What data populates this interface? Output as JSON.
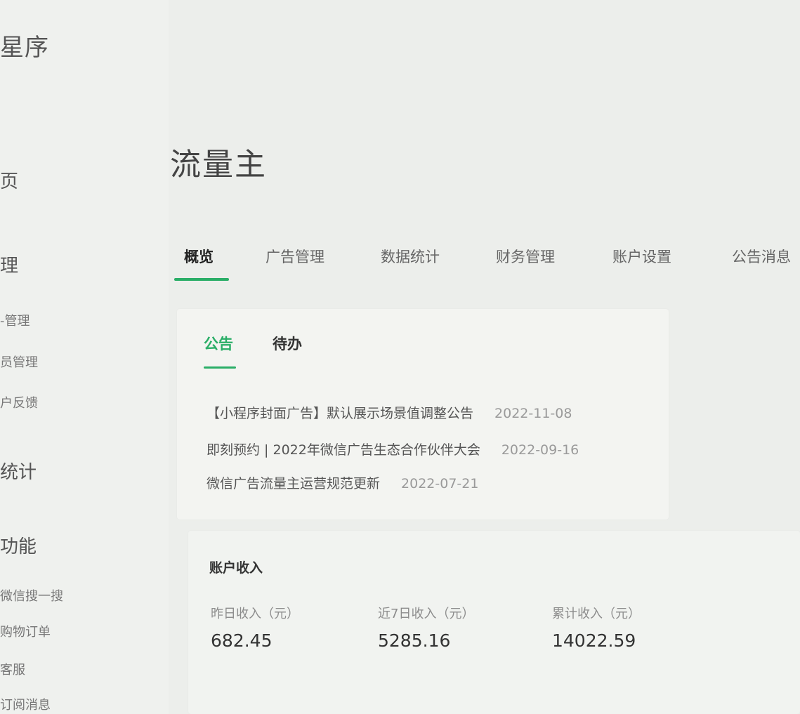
{
  "sidebar": {
    "brand": "星序",
    "items": [
      {
        "label": "页",
        "size": "big"
      },
      {
        "label": "理",
        "size": "big"
      },
      {
        "label": "-管理",
        "size": "small"
      },
      {
        "label": "员管理",
        "size": "small"
      },
      {
        "label": "户反馈",
        "size": "small"
      },
      {
        "label": "统计",
        "size": "big"
      },
      {
        "label": "功能",
        "size": "big"
      },
      {
        "label": "微信搜一搜",
        "size": "small"
      },
      {
        "label": "购物订单",
        "size": "small"
      },
      {
        "label": "客服",
        "size": "small"
      },
      {
        "label": "订阅消息",
        "size": "small"
      }
    ]
  },
  "page": {
    "title": "流量主"
  },
  "tabs": [
    {
      "label": "概览",
      "active": true
    },
    {
      "label": "广告管理",
      "active": false
    },
    {
      "label": "数据统计",
      "active": false
    },
    {
      "label": "财务管理",
      "active": false
    },
    {
      "label": "账户设置",
      "active": false
    },
    {
      "label": "公告消息",
      "active": false
    }
  ],
  "notice_panel": {
    "tabs": [
      {
        "label": "公告",
        "active": true
      },
      {
        "label": "待办",
        "active": false
      }
    ],
    "notices": [
      {
        "title": "【小程序封面广告】默认展示场景值调整公告",
        "date": "2022-11-08"
      },
      {
        "title": "即刻预约 | 2022年微信广告生态合作伙伴大会",
        "date": "2022-09-16"
      },
      {
        "title": "微信广告流量主运营规范更新",
        "date": "2022-07-21"
      }
    ]
  },
  "income": {
    "heading": "账户收入",
    "stats": [
      {
        "label": "昨日收入（元）",
        "value": "682.45"
      },
      {
        "label": "近7日收入（元）",
        "value": "5285.16"
      },
      {
        "label": "累计收入（元）",
        "value": "14022.59"
      }
    ]
  },
  "colors": {
    "accent": "#2aae67",
    "background": "#eceeeb"
  }
}
